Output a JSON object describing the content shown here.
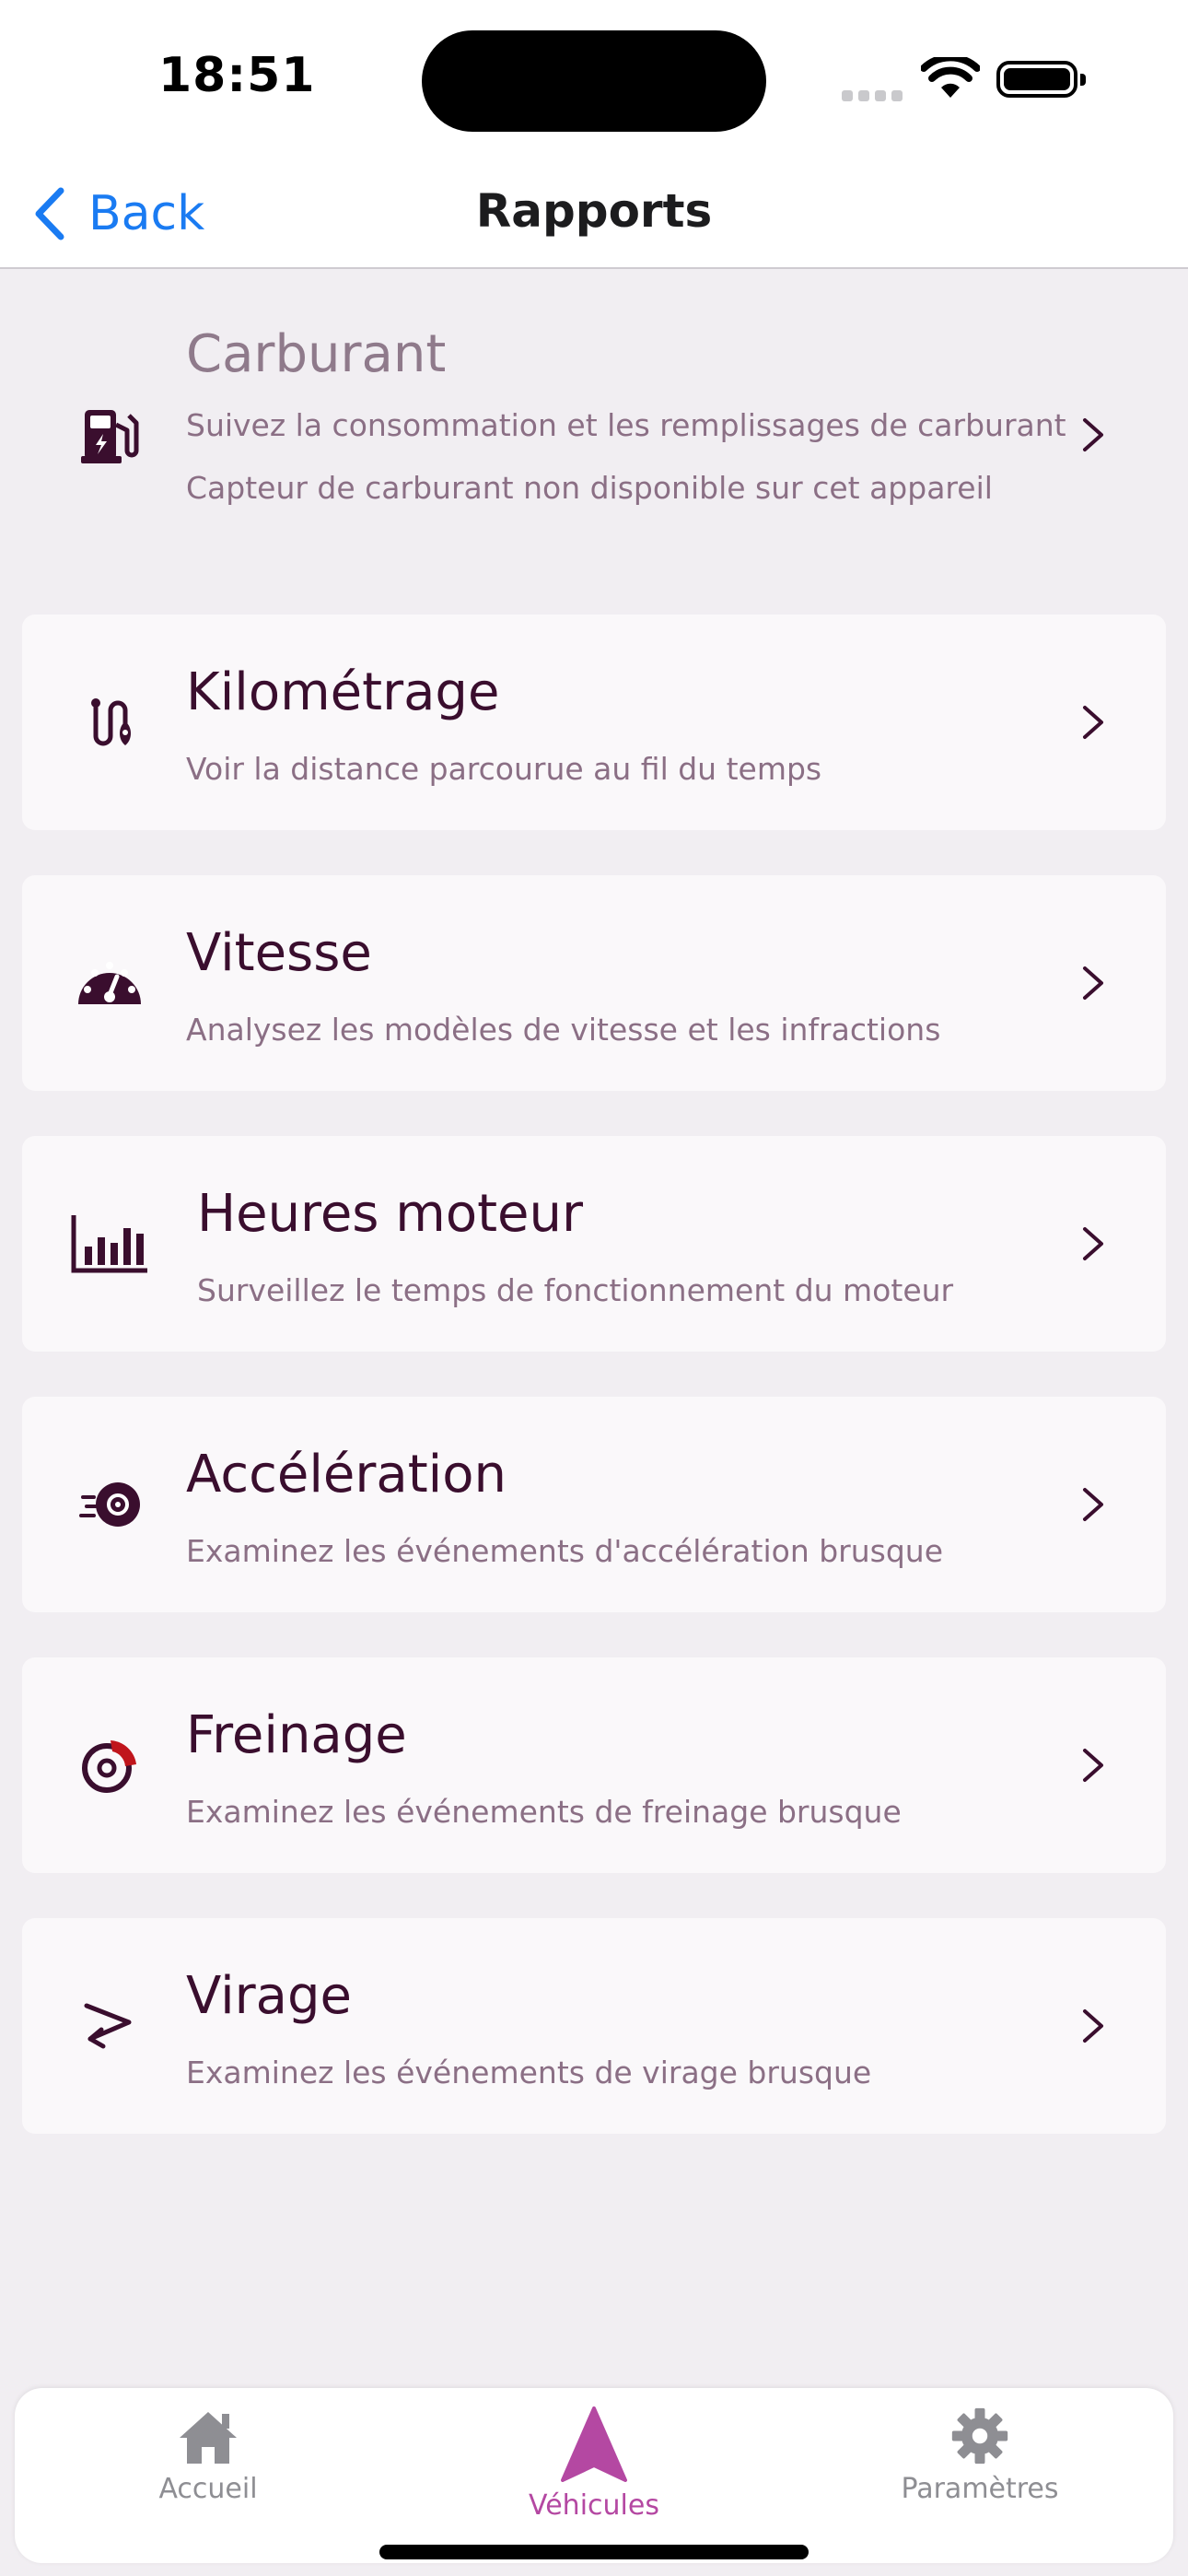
{
  "status_bar": {
    "time": "18:51"
  },
  "nav": {
    "back_label": "Back",
    "title": "Rapports"
  },
  "reports": [
    {
      "id": "carburant",
      "icon": "fuel-pump-icon",
      "title": "Carburant",
      "subtitle": "Suivez la consommation et les remplissages de carburant",
      "note": "Capteur de carburant non disponible sur cet appareil",
      "enabled": false
    },
    {
      "id": "kilometrage",
      "icon": "route-icon",
      "title": "Kilométrage",
      "subtitle": "Voir la distance parcourue au fil du temps",
      "enabled": true
    },
    {
      "id": "vitesse",
      "icon": "speedometer-icon",
      "title": "Vitesse",
      "subtitle": "Analysez les modèles de vitesse et les infractions",
      "enabled": true
    },
    {
      "id": "heures-moteur",
      "icon": "bar-chart-icon",
      "title": "Heures moteur",
      "subtitle": "Surveillez le temps de fonctionnement du moteur",
      "enabled": true
    },
    {
      "id": "acceleration",
      "icon": "acceleration-icon",
      "title": "Accélération",
      "subtitle": "Examinez les événements d'accélération brusque",
      "enabled": true
    },
    {
      "id": "freinage",
      "icon": "brake-icon",
      "title": "Freinage",
      "subtitle": "Examinez les événements de freinage brusque",
      "enabled": true
    },
    {
      "id": "virage",
      "icon": "turn-icon",
      "title": "Virage",
      "subtitle": "Examinez les événements de virage brusque",
      "enabled": true
    }
  ],
  "tabs": [
    {
      "label": "Accueil",
      "icon": "home-icon",
      "active": false
    },
    {
      "label": "Véhicules",
      "icon": "navigation-arrow-icon",
      "active": true
    },
    {
      "label": "Paramètres",
      "icon": "gear-icon",
      "active": false
    }
  ],
  "colors": {
    "accent": "#B448A2",
    "link_blue": "#1A7BF2",
    "title_text": "#3A0E2E",
    "subtitle_text": "#8B6F85",
    "background": "#F1EEF2",
    "brake_red": "#C0151C"
  }
}
